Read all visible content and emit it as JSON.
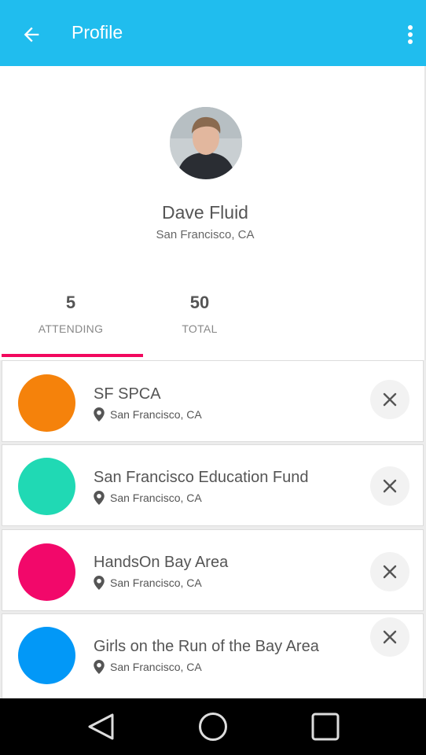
{
  "header": {
    "title": "Profile",
    "back_icon": "arrow-left-icon",
    "menu_icon": "more-vert-icon",
    "color": "#20bdee"
  },
  "profile": {
    "name": "Dave Fluid",
    "location": "San Francisco, CA"
  },
  "tabs": [
    {
      "count": "5",
      "label": "ATTENDING",
      "active": true
    },
    {
      "count": "50",
      "label": "TOTAL",
      "active": false
    }
  ],
  "accent": "#f2085e",
  "events": [
    {
      "name": "SF SPCA",
      "location": "San Francisco, CA",
      "color": "#f5820b"
    },
    {
      "name": "San Francisco Education Fund",
      "location": "San Francisco, CA",
      "color": "#20d9b4"
    },
    {
      "name": "HandsOn Bay Area",
      "location": "San Francisco, CA",
      "color": "#f2086a"
    },
    {
      "name": "Girls on the Run of the Bay Area",
      "location": "San Francisco, CA",
      "color": "#0298f7"
    }
  ],
  "navbar": {
    "icons": [
      "back-triangle-icon",
      "home-circle-icon",
      "recents-square-icon"
    ]
  }
}
